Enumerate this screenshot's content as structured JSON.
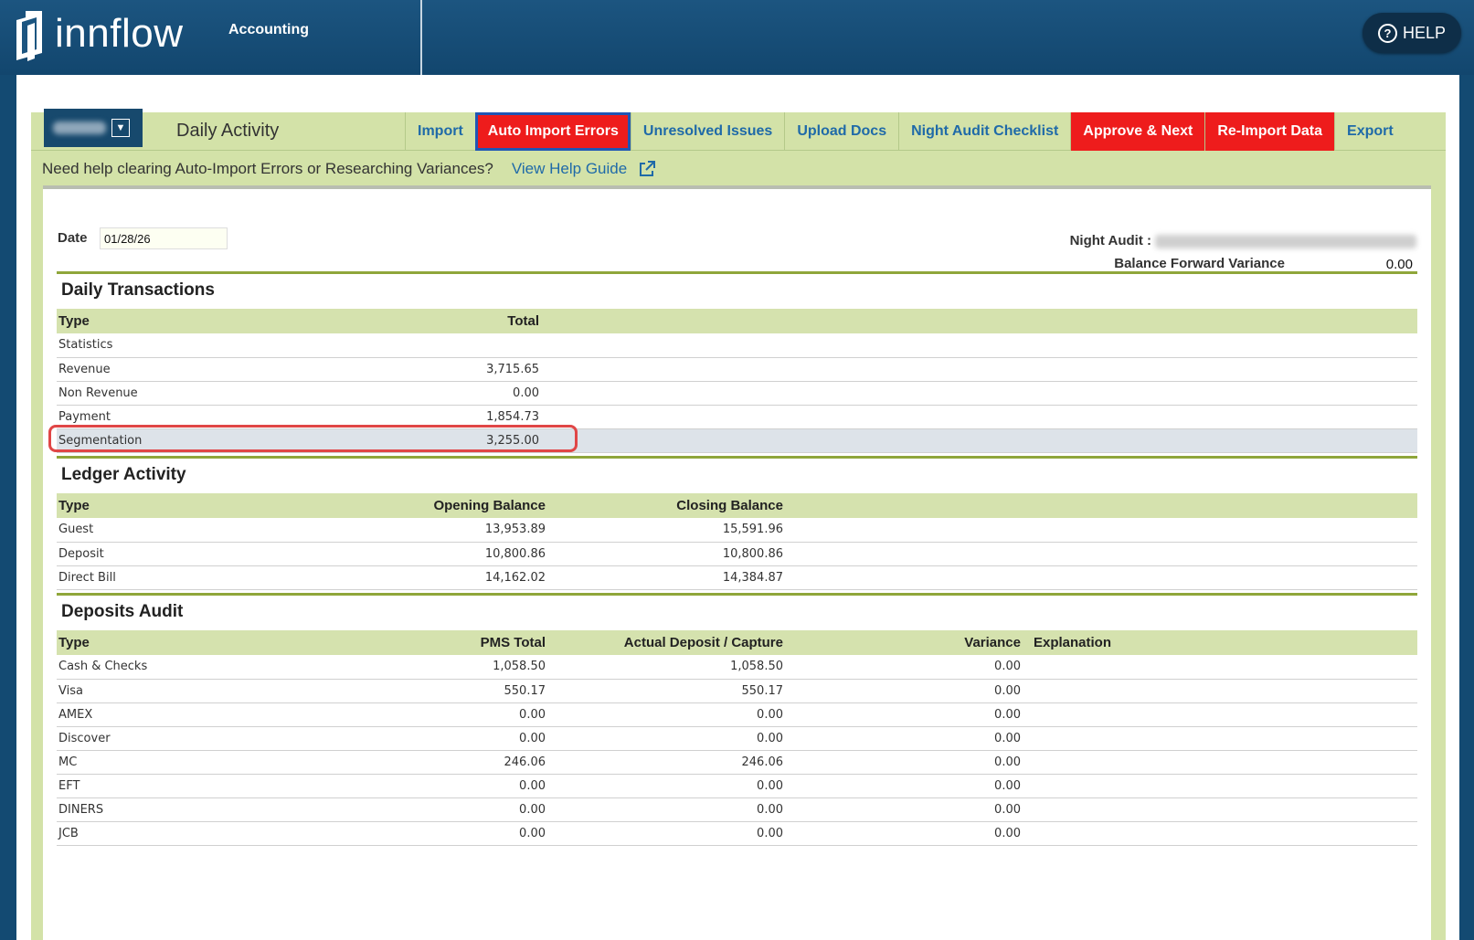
{
  "app": {
    "brand": "innflow",
    "module": "Accounting",
    "help_label": "HELP"
  },
  "nav": {
    "title": "Daily Activity",
    "tabs": [
      {
        "label": "Import",
        "style": "normal"
      },
      {
        "label": "Auto Import Errors",
        "style": "red-outlined"
      },
      {
        "label": "Unresolved Issues",
        "style": "normal"
      },
      {
        "label": "Upload Docs",
        "style": "normal"
      },
      {
        "label": "Night Audit Checklist",
        "style": "normal"
      },
      {
        "label": "Approve & Next",
        "style": "red"
      },
      {
        "label": "Re-Import Data",
        "style": "red"
      },
      {
        "label": "Export",
        "style": "normal"
      }
    ]
  },
  "help_line": {
    "text": "Need help clearing Auto-Import Errors or Researching Variances?",
    "link": "View Help Guide"
  },
  "header_info": {
    "date_label": "Date",
    "date_value": "01/28/26",
    "night_audit_label": "Night Audit :",
    "bfv_label": "Balance Forward Variance",
    "bfv_value": "0.00"
  },
  "daily_transactions": {
    "title": "Daily Transactions",
    "columns": [
      "Type",
      "Total"
    ],
    "rows": [
      [
        "Statistics",
        ""
      ],
      [
        "Revenue",
        "3,715.65"
      ],
      [
        "Non Revenue",
        "0.00"
      ],
      [
        "Payment",
        "1,854.73"
      ],
      [
        "Segmentation",
        "3,255.00"
      ]
    ],
    "highlighted_row": 4
  },
  "ledger_activity": {
    "title": "Ledger Activity",
    "columns": [
      "Type",
      "Opening Balance",
      "Closing Balance"
    ],
    "rows": [
      [
        "Guest",
        "13,953.89",
        "15,591.96"
      ],
      [
        "Deposit",
        "10,800.86",
        "10,800.86"
      ],
      [
        "Direct Bill",
        "14,162.02",
        "14,384.87"
      ]
    ]
  },
  "deposits_audit": {
    "title": "Deposits Audit",
    "columns": [
      "Type",
      "PMS Total",
      "Actual Deposit / Capture",
      "Variance",
      "Explanation"
    ],
    "rows": [
      [
        "Cash & Checks",
        "1,058.50",
        "1,058.50",
        "0.00",
        ""
      ],
      [
        "Visa",
        "550.17",
        "550.17",
        "0.00",
        ""
      ],
      [
        "AMEX",
        "0.00",
        "0.00",
        "0.00",
        ""
      ],
      [
        "Discover",
        "0.00",
        "0.00",
        "0.00",
        ""
      ],
      [
        "MC",
        "246.06",
        "246.06",
        "0.00",
        ""
      ],
      [
        "EFT",
        "0.00",
        "0.00",
        "0.00",
        ""
      ],
      [
        "DINERS",
        "0.00",
        "0.00",
        "0.00",
        ""
      ],
      [
        "JCB",
        "0.00",
        "0.00",
        "0.00",
        ""
      ]
    ]
  },
  "colors": {
    "header_bg": "#134a72",
    "frame_green": "#d3e2a8",
    "tab_red": "#ee1c1c",
    "link_blue": "#1f6aa8",
    "section_rule": "#8fa63a",
    "highlight_ring": "#e04646"
  }
}
